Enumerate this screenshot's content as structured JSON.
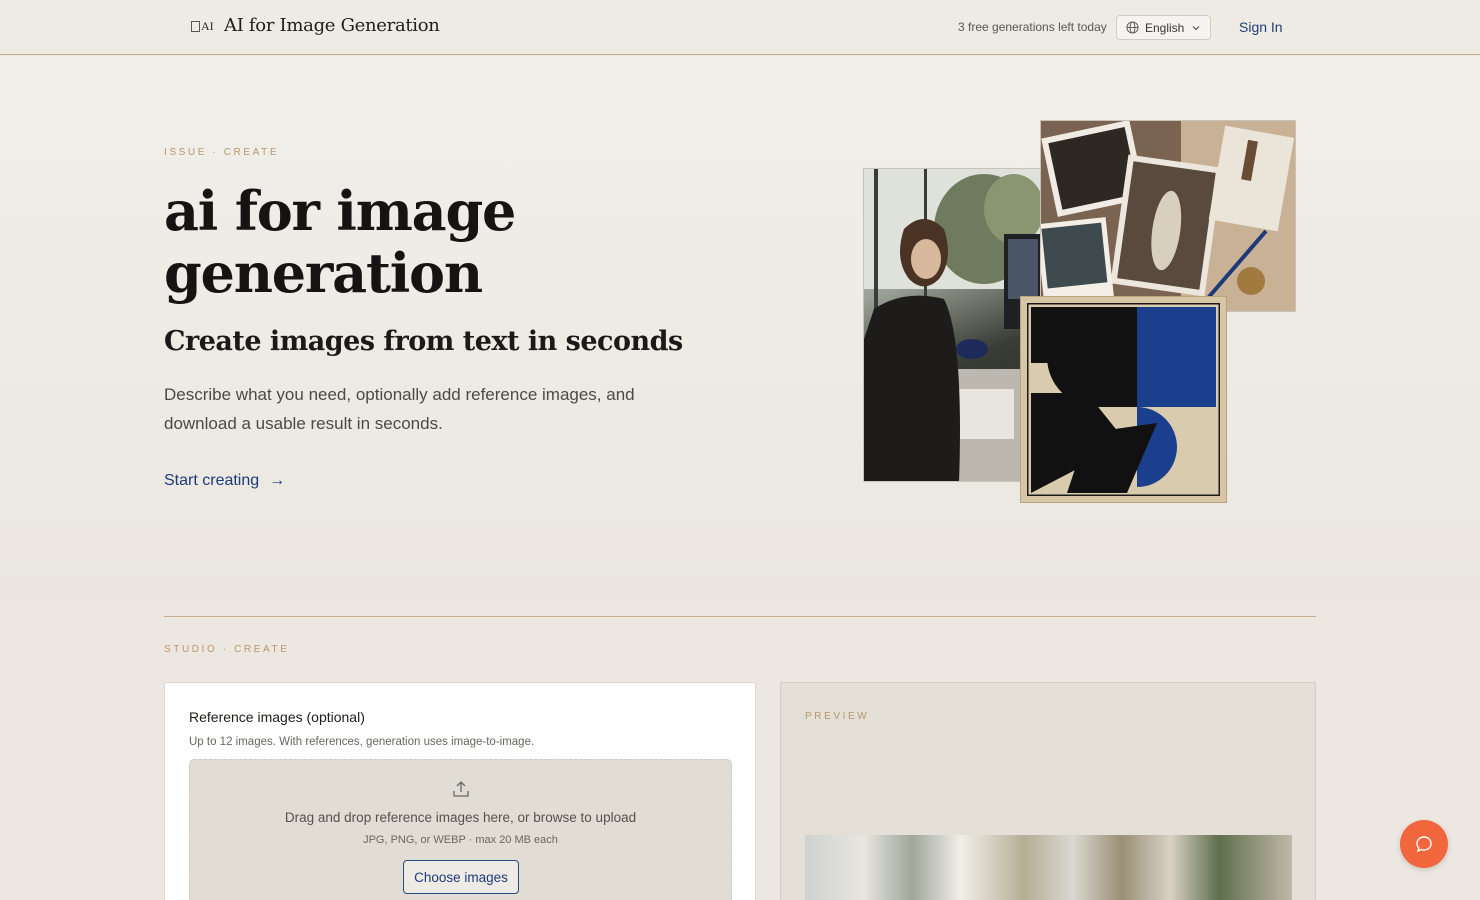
{
  "header": {
    "logo_mark": "AI",
    "title": "AI for Image Generation",
    "credits": "3 free generations left today",
    "language": "English",
    "signin": "Sign In"
  },
  "hero": {
    "eyebrow": "ISSUE · CREATE",
    "title": "ai for image generation",
    "subtitle": "Create images from text in seconds",
    "description": "Describe what you need, optionally add reference images, and download a usable result in seconds.",
    "cta": "Start creating",
    "cta_arrow": "→"
  },
  "studio": {
    "eyebrow": "STUDIO · CREATE",
    "reference": {
      "title": "Reference images (optional)",
      "help": "Up to 12 images. With references, generation uses image-to-image.",
      "drop_text": "Drag and drop reference images here, or browse to upload",
      "formats": "JPG, PNG, or WEBP · max 20 MB each",
      "button": "Choose images"
    },
    "preview": {
      "label": "PREVIEW"
    }
  },
  "colors": {
    "accent_gold": "#b8966a",
    "link_blue": "#1f3a78",
    "chat_orange": "#f2663d"
  },
  "icons": [
    "globe-icon",
    "chevron-down-icon",
    "arrow-right-icon",
    "upload-icon",
    "chat-icon"
  ]
}
